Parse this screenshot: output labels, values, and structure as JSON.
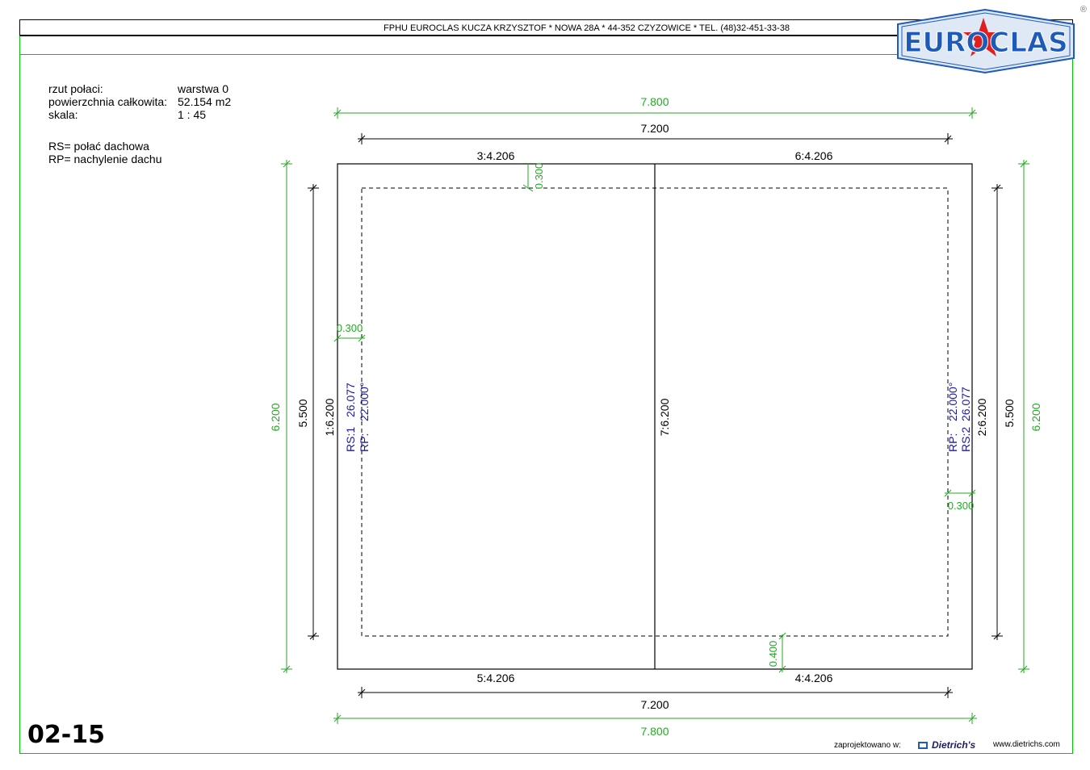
{
  "header": {
    "company_line": "FPHU EUROCLAS KUCZA KRZYSZTOF * NOWA 28A * 44-352 CZYZOWICE * TEL. (48)32-451-33-38",
    "logo_text": "EUROCLAS",
    "registered_mark": "®"
  },
  "info": {
    "rows": [
      {
        "label": "rzut połaci:",
        "value": "warstwa 0"
      },
      {
        "label": "powierzchnia całkowita:",
        "value": "52.154 m2"
      },
      {
        "label": "skala:",
        "value": "1 : 45"
      }
    ],
    "legend": [
      "RS= połać dachowa",
      "RP= nachylenie dachu"
    ]
  },
  "drawing": {
    "dim_outer_top": "7.800",
    "dim_inner_top": "7.200",
    "edge_top_left": "3:4.206",
    "edge_top_right": "6:4.206",
    "overhang_top": "0.300",
    "dim_outer_left": "6.200",
    "dim_inner_left": "5.500",
    "edge_left": "1:6.200",
    "overhang_left": "0.300",
    "rs_left_label": "RS:1",
    "rs_left_value": "26.077",
    "rp_left_label": "RP:",
    "rp_left_value": "22.000°",
    "edge_middle": "7:6.200",
    "rp_right_label": "RP:",
    "rp_right_value": "22.000°",
    "rs_right_label": "RS:2",
    "rs_right_value": "26.077",
    "edge_right": "2:6.200",
    "dim_inner_right": "5.500",
    "dim_outer_right": "6.200",
    "overhang_right": "0.300",
    "overhang_bottom": "0.400",
    "edge_bottom_left": "5:4.206",
    "edge_bottom_right": "4:4.206",
    "dim_inner_bottom": "7.200",
    "dim_outer_bottom": "7.800"
  },
  "footer": {
    "sheet_code": "02-15",
    "designed_with": "zaprojektowano w:",
    "brand": "Dietrich's",
    "website": "www.dietrichs.com"
  },
  "colors": {
    "green": "#22aa22",
    "blue": "#1a1aa6",
    "black": "#000000",
    "logo_blue": "#1e5bb8",
    "logo_red": "#e02020"
  }
}
